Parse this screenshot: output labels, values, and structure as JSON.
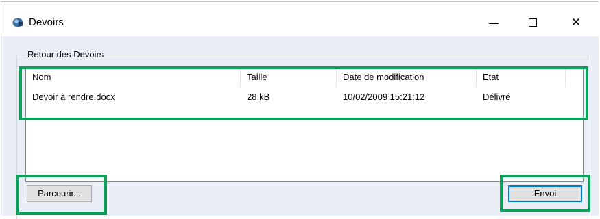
{
  "window": {
    "title": "Devoirs",
    "controls": {
      "minimize_icon": "minimize-icon",
      "maximize_icon": "maximize-icon",
      "close_icon": "close-icon",
      "close_glyph": "✕"
    }
  },
  "group": {
    "label": "Retour des Devoirs"
  },
  "table": {
    "columns": [
      "Nom",
      "Taille",
      "Date de modification",
      "Etat"
    ],
    "rows": [
      {
        "name": "Devoir à rendre.docx",
        "size": "28 kB",
        "modified": "10/02/2009 15:21:12",
        "status": "Délivré"
      }
    ]
  },
  "buttons": {
    "browse": "Parcourir...",
    "send": "Envoi"
  },
  "colors": {
    "highlight": "#0aa05a",
    "client_bg": "#e9eef7",
    "default_button_border": "#0078d7"
  }
}
